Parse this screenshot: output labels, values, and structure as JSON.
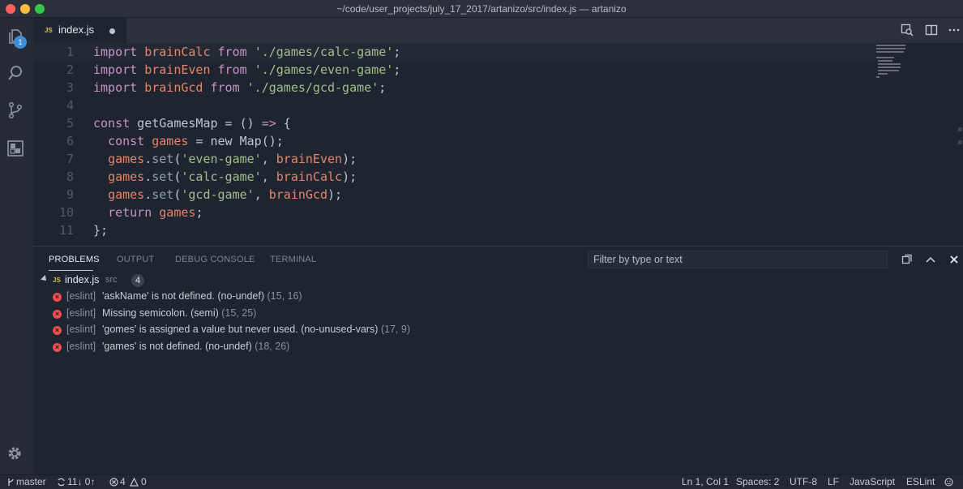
{
  "window": {
    "title": "~/code/user_projects/july_17_2017/artanizo/src/index.js — artanizo"
  },
  "activity_bar": {
    "explorer_badge": "1"
  },
  "tab": {
    "lang": "JS",
    "name": "index.js"
  },
  "editor": {
    "lines": [
      {
        "n": "1",
        "tokens": [
          [
            "kw",
            "import"
          ],
          [
            "pn",
            " "
          ],
          [
            "id",
            "brainCalc"
          ],
          [
            "pn",
            " "
          ],
          [
            "kw",
            "from"
          ],
          [
            "pn",
            " "
          ],
          [
            "str",
            "'./games/calc-game'"
          ],
          [
            "pn",
            ";"
          ]
        ]
      },
      {
        "n": "2",
        "tokens": [
          [
            "kw",
            "import"
          ],
          [
            "pn",
            " "
          ],
          [
            "id",
            "brainEven"
          ],
          [
            "pn",
            " "
          ],
          [
            "kw",
            "from"
          ],
          [
            "pn",
            " "
          ],
          [
            "str",
            "'./games/even-game'"
          ],
          [
            "pn",
            ";"
          ]
        ]
      },
      {
        "n": "3",
        "tokens": [
          [
            "kw",
            "import"
          ],
          [
            "pn",
            " "
          ],
          [
            "id",
            "brainGcd"
          ],
          [
            "pn",
            " "
          ],
          [
            "kw",
            "from"
          ],
          [
            "pn",
            " "
          ],
          [
            "str",
            "'./games/gcd-game'"
          ],
          [
            "pn",
            ";"
          ]
        ]
      },
      {
        "n": "4",
        "tokens": []
      },
      {
        "n": "5",
        "tokens": [
          [
            "kw",
            "const"
          ],
          [
            "pn",
            " getGamesMap = () "
          ],
          [
            "kw",
            "=>"
          ],
          [
            "pn",
            " {"
          ]
        ]
      },
      {
        "n": "6",
        "tokens": [
          [
            "pn",
            "  "
          ],
          [
            "kw",
            "const"
          ],
          [
            "pn",
            " "
          ],
          [
            "id",
            "games"
          ],
          [
            "pn",
            " = new Map();"
          ]
        ]
      },
      {
        "n": "7",
        "tokens": [
          [
            "pn",
            "  "
          ],
          [
            "id",
            "games"
          ],
          [
            "pn",
            "."
          ],
          [
            "fn",
            "set"
          ],
          [
            "pn",
            "("
          ],
          [
            "str",
            "'even-game'"
          ],
          [
            "pn",
            ", "
          ],
          [
            "id",
            "brainEven"
          ],
          [
            "pn",
            ");"
          ]
        ]
      },
      {
        "n": "8",
        "tokens": [
          [
            "pn",
            "  "
          ],
          [
            "id",
            "games"
          ],
          [
            "pn",
            "."
          ],
          [
            "fn",
            "set"
          ],
          [
            "pn",
            "("
          ],
          [
            "str",
            "'calc-game'"
          ],
          [
            "pn",
            ", "
          ],
          [
            "id",
            "brainCalc"
          ],
          [
            "pn",
            ");"
          ]
        ]
      },
      {
        "n": "9",
        "tokens": [
          [
            "pn",
            "  "
          ],
          [
            "id",
            "games"
          ],
          [
            "pn",
            "."
          ],
          [
            "fn",
            "set"
          ],
          [
            "pn",
            "("
          ],
          [
            "str",
            "'gcd-game'"
          ],
          [
            "pn",
            ", "
          ],
          [
            "id",
            "brainGcd"
          ],
          [
            "pn",
            ");"
          ]
        ]
      },
      {
        "n": "10",
        "tokens": [
          [
            "pn",
            "  "
          ],
          [
            "kw",
            "return"
          ],
          [
            "pn",
            " "
          ],
          [
            "id",
            "games"
          ],
          [
            "pn",
            ";"
          ]
        ]
      },
      {
        "n": "11",
        "tokens": [
          [
            "pn",
            "};"
          ]
        ]
      }
    ]
  },
  "panel": {
    "tabs": [
      "PROBLEMS",
      "OUTPUT",
      "DEBUG CONSOLE",
      "TERMINAL"
    ],
    "filter_placeholder": "Filter by type or text",
    "file": {
      "lang": "JS",
      "name": "index.js",
      "path": "src",
      "count": "4"
    },
    "problems": [
      {
        "source": "[eslint]",
        "message": "'askName' is not defined. (no-undef)",
        "pos": "(15, 16)"
      },
      {
        "source": "[eslint]",
        "message": "Missing semicolon. (semi)",
        "pos": "(15, 25)"
      },
      {
        "source": "[eslint]",
        "message": "'gomes' is assigned a value but never used. (no-unused-vars)",
        "pos": "(17, 9)"
      },
      {
        "source": "[eslint]",
        "message": "'games' is not defined. (no-undef)",
        "pos": "(18, 26)"
      }
    ]
  },
  "status": {
    "branch": "master",
    "sync": "11↓ 0↑",
    "errors": "4",
    "warnings": "0",
    "position": "Ln 1, Col 1",
    "spaces": "Spaces: 2",
    "encoding": "UTF-8",
    "eol": "LF",
    "language": "JavaScript",
    "linter": "ESLint"
  },
  "colors": {
    "keyword": "#c594c5",
    "identifier": "#e5856a",
    "string": "#a3be8c",
    "error": "#ee4e4e"
  }
}
